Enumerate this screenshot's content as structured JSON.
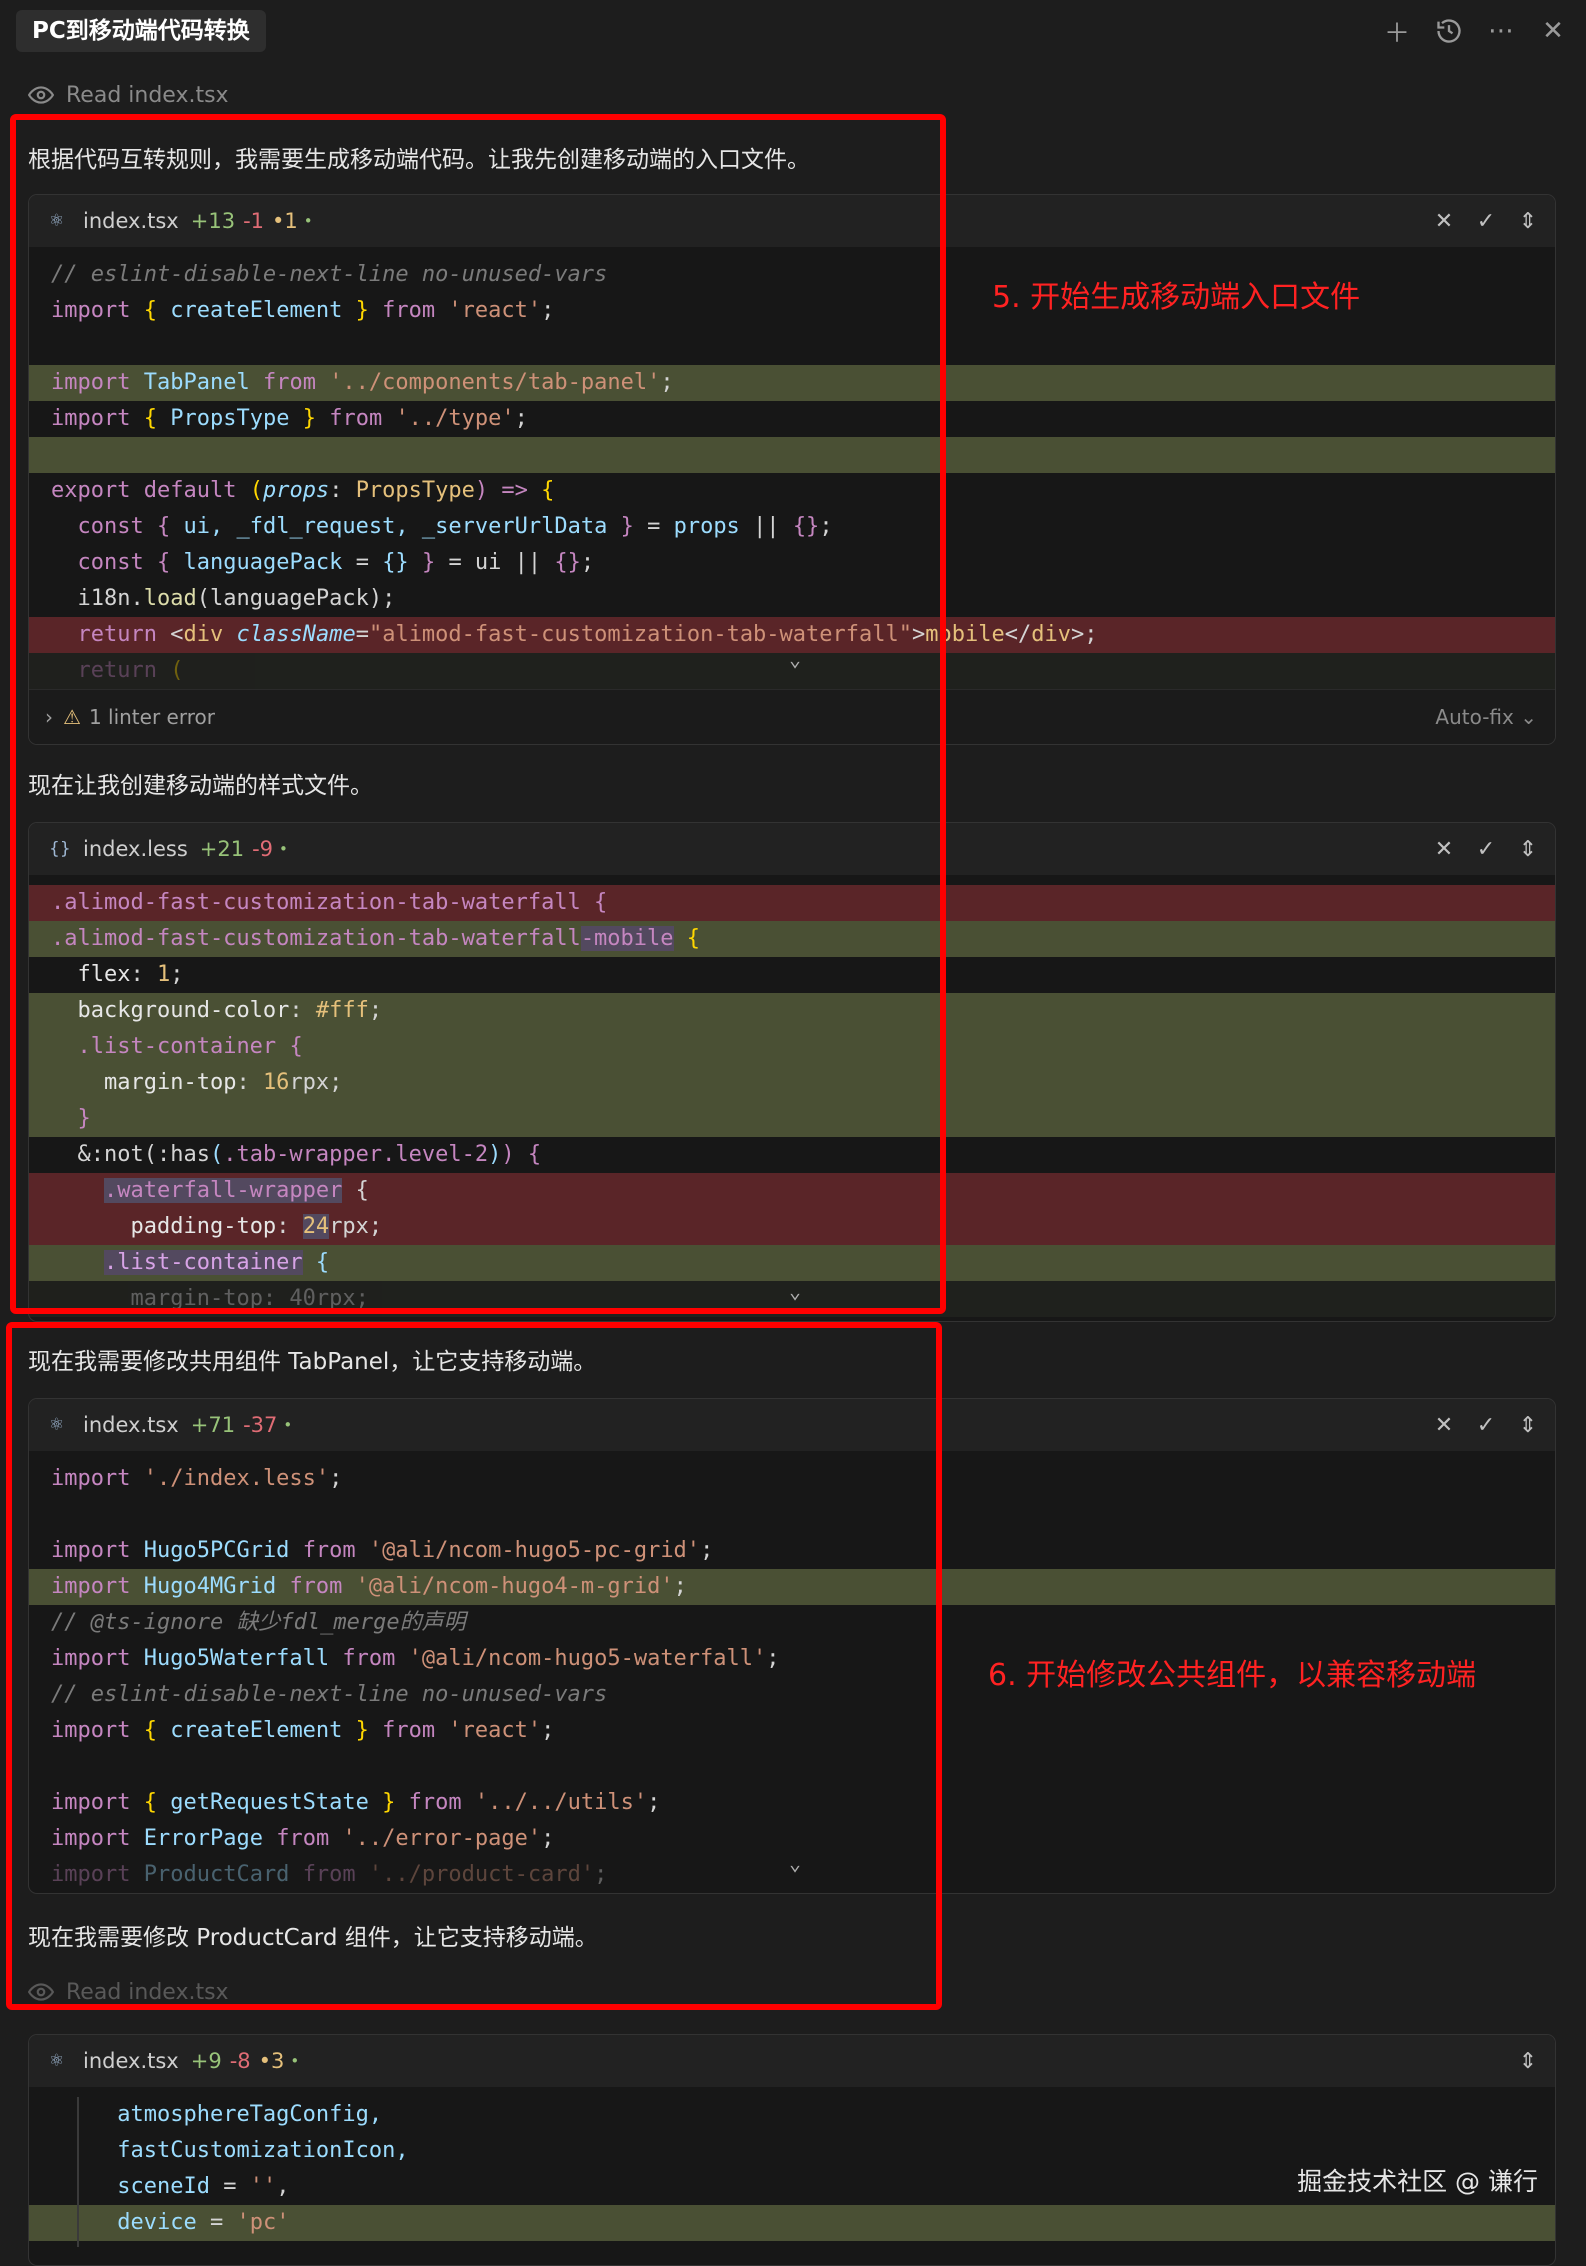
{
  "header": {
    "title": "PC到移动端代码转换",
    "icons": [
      "plus-icon",
      "history-icon",
      "more-icon",
      "close-icon"
    ]
  },
  "read_label_1": "Read index.tsx",
  "read_label_2": "Read index.tsx",
  "messages": {
    "m1": "根据代码互转规则，我需要生成移动端代码。让我先创建移动端的入口文件。",
    "m2": "现在让我创建移动端的样式文件。",
    "m3": "现在我需要修改共用组件 TabPanel，让它支持移动端。",
    "m4": "现在我需要修改 ProductCard 组件，让它支持移动端。"
  },
  "cards": {
    "c1": {
      "file": "index.tsx",
      "added": "+13",
      "removed": "-1",
      "warn": "•1",
      "dot": "•"
    },
    "c2": {
      "file": "index.less",
      "added": "+21",
      "removed": "-9",
      "dot": "•"
    },
    "c3": {
      "file": "index.tsx",
      "added": "+71",
      "removed": "-37",
      "dot": "•"
    },
    "c4": {
      "file": "index.tsx",
      "added": "+9",
      "removed": "-8",
      "warn": "•3",
      "dot": "•"
    }
  },
  "card1_footer": {
    "linter": "1 linter error",
    "autofix": "Auto-fix"
  },
  "code1": {
    "l1": "// eslint-disable-next-line no-unused-vars",
    "l2": [
      "import",
      "{",
      "createElement",
      "}",
      "from",
      "'react'",
      ";"
    ],
    "l4": [
      "import",
      "TabPanel",
      "from",
      "'../components/tab-panel'",
      ";"
    ],
    "l5": [
      "import",
      "{",
      "PropsType",
      "}",
      "from",
      "'../type'",
      ";"
    ],
    "l7": [
      "export",
      "default",
      "(",
      "props",
      ": ",
      "PropsType",
      ") =>",
      "{"
    ],
    "l8": [
      "const",
      "{",
      "ui, _fdl_request, _serverUrlData",
      "}",
      "=",
      "props",
      "||",
      "{}",
      ";"
    ],
    "l9": [
      "const",
      "{",
      "languagePack",
      "=",
      "{}",
      "}",
      "= ui ||",
      "{}",
      ";"
    ],
    "l10": [
      "i18n.",
      "load",
      "(languagePack);"
    ],
    "l11": [
      "return",
      "<",
      "div",
      "className",
      "=",
      "\"alimod-fast-customization-tab-waterfall\"",
      ">",
      "mobile",
      "</",
      "div",
      ">;"
    ],
    "l12": [
      "return",
      "("
    ]
  },
  "code2": {
    "l1": ".alimod-fast-customization-tab-waterfall {",
    "l2a": ".alimod-fast-customization-tab-waterfall",
    "l2b": "-mobile",
    "l2c": "{",
    "l3": [
      "flex",
      ": ",
      "1",
      ";"
    ],
    "l4": [
      "background-color",
      ": ",
      "#fff",
      ";"
    ],
    "l5": [
      ".list-container",
      "{"
    ],
    "l6": [
      "margin-top",
      ": ",
      "16",
      "rpx;"
    ],
    "l7": "}",
    "l8": [
      "&:not(:has",
      "(",
      ".tab-wrapper.level-2",
      ")",
      ") {"
    ],
    "l9": [
      ".waterfall-wrapper",
      "{"
    ],
    "l10": [
      "padding-top",
      ": ",
      "24",
      "rpx;"
    ],
    "l11": [
      ".list-container",
      "{"
    ],
    "l12": "margin-top: 40rpx;"
  },
  "code3": {
    "l1": [
      "import",
      "'./index.less'",
      ";"
    ],
    "l3": [
      "import",
      "Hugo5PCGrid",
      "from",
      "'@ali/ncom-hugo5-pc-grid'",
      ";"
    ],
    "l4": [
      "import",
      "Hugo4MGrid",
      "from",
      "'@ali/ncom-hugo4-m-grid'",
      ";"
    ],
    "l5": "// @ts-ignore 缺少fdl_merge的声明",
    "l6": [
      "import",
      "Hugo5Waterfall",
      "from",
      "'@ali/ncom-hugo5-waterfall'",
      ";"
    ],
    "l7": "// eslint-disable-next-line no-unused-vars",
    "l8": [
      "import",
      "{",
      "createElement",
      "}",
      "from",
      "'react'",
      ";"
    ],
    "l10": [
      "import",
      "{",
      "getRequestState",
      "}",
      "from",
      "'../../utils'",
      ";"
    ],
    "l11": [
      "import",
      "ErrorPage",
      "from",
      "'../error-page'",
      ";"
    ],
    "l12": [
      "import",
      "ProductCard",
      "from",
      "'../product-card'",
      ";"
    ]
  },
  "code4": {
    "l1": "atmosphereTagConfig,",
    "l2": "fastCustomizationIcon,",
    "l3": [
      "sceneId",
      " = ",
      "''",
      ","
    ],
    "l4": [
      "device",
      " = ",
      "'pc'"
    ]
  },
  "annotations": {
    "a5": "5. 开始生成移动端入口文件",
    "a6": "6. 开始修改公共组件，以兼容移动端"
  },
  "watermark": "掘金技术社区 @ 谦行"
}
